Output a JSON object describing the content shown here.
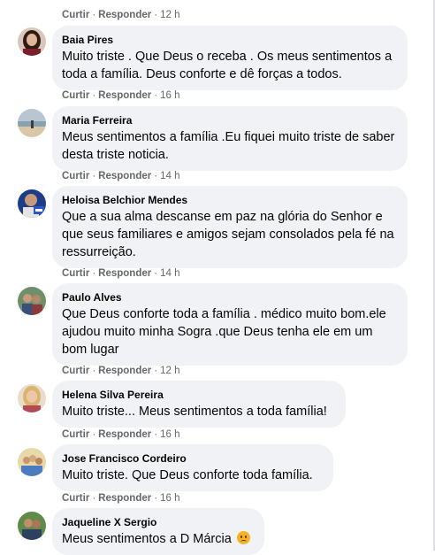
{
  "action_labels": {
    "like": "Curtir",
    "reply": "Responder",
    "separator": "·"
  },
  "top_actions": {
    "time": "12 h"
  },
  "comments": [
    {
      "author": "Baia Pires",
      "text": "Muito triste . Que Deus o receba . Os meus sentimentos a toda a família. Deus conforte e dê forças a todos.",
      "time": "16 h",
      "avatar_icon": "profile-photo-woman-dark-hair"
    },
    {
      "author": "Maria Ferreira",
      "text": "Meus sentimentos a família .Eu fiquei muito triste de saber desta triste noticia.",
      "time": "14 h",
      "avatar_icon": "profile-photo-beach"
    },
    {
      "author": "Heloisa Belchior Mendes",
      "text": "Que a sua alma descanse em paz na glória do Senhor e que seus familiares e amigos sejam consolados pela fé na ressurreição.",
      "time": "14 h",
      "avatar_icon": "profile-photo-with-badge"
    },
    {
      "author": "Paulo Alves",
      "text": "Que Deus conforte toda a família . médico muito bom.ele ajudou muito minha Sogra .que Deus tenha ele em um bom lugar",
      "time": "12 h",
      "avatar_icon": "profile-photo-couple"
    },
    {
      "author": "Helena Silva Pereira",
      "text": "Muito triste... Meus sentimentos a toda família!",
      "time": "16 h",
      "avatar_icon": "profile-photo-blonde-woman"
    },
    {
      "author": "Jose Francisco Cordeiro",
      "text": "Muito triste. Que Deus conforte toda família.",
      "time": "16 h",
      "avatar_icon": "profile-photo-family"
    },
    {
      "author": "Jaqueline X Sergio",
      "text": "Meus sentimentos a D Márcia",
      "time": "",
      "avatar_icon": "profile-photo-couple-outdoor",
      "emoji": "sad-face-emoji"
    }
  ],
  "colors": {
    "bubble_bg": "#f0f2f5",
    "text": "#050505",
    "secondary_text": "#65676b"
  }
}
